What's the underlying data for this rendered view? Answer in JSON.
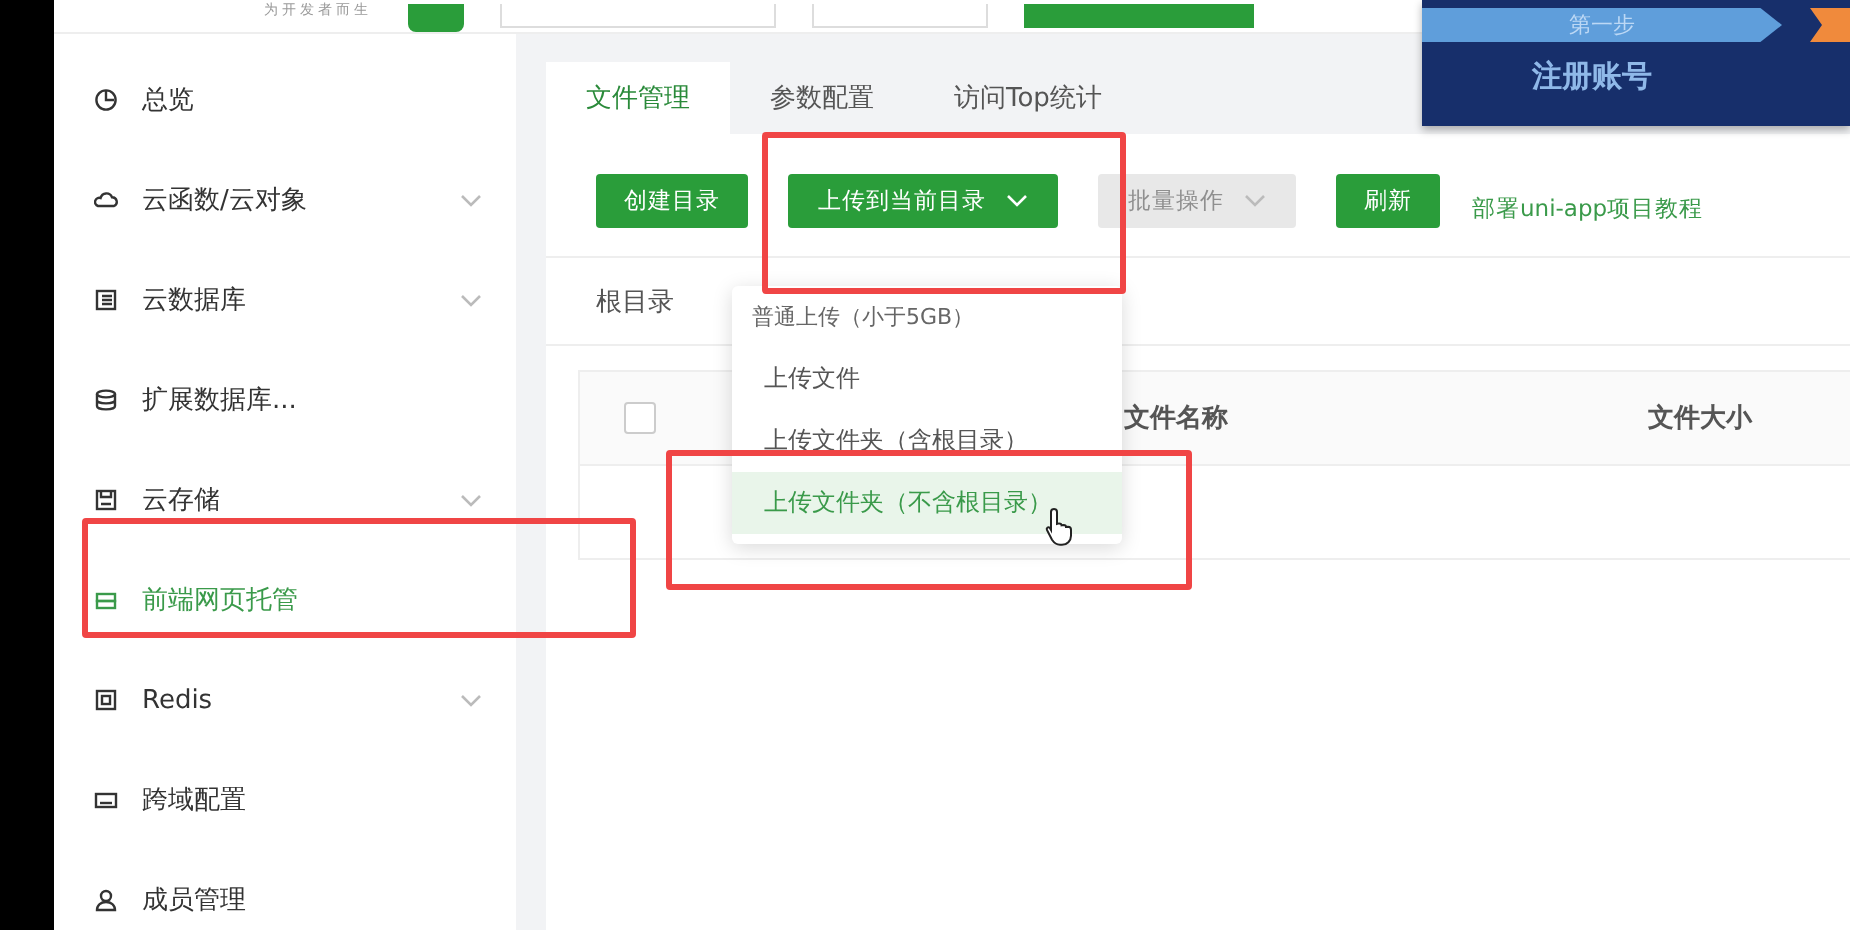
{
  "header": {
    "slogan": "为开发者而生"
  },
  "banner": {
    "step": "第一步",
    "title": "注册账号"
  },
  "sidebar": {
    "items": [
      {
        "label": "总览",
        "expandable": false,
        "selected": false
      },
      {
        "label": "云函数/云对象",
        "expandable": true,
        "selected": false
      },
      {
        "label": "云数据库",
        "expandable": true,
        "selected": false
      },
      {
        "label": "扩展数据库...",
        "expandable": false,
        "selected": false
      },
      {
        "label": "云存储",
        "expandable": true,
        "selected": false
      },
      {
        "label": "前端网页托管",
        "expandable": false,
        "selected": true
      },
      {
        "label": "Redis",
        "expandable": true,
        "selected": false
      },
      {
        "label": "跨域配置",
        "expandable": false,
        "selected": false
      },
      {
        "label": "成员管理",
        "expandable": false,
        "selected": false
      }
    ]
  },
  "tabs": [
    {
      "label": "文件管理",
      "selected": true
    },
    {
      "label": "参数配置",
      "selected": false
    },
    {
      "label": "访问Top统计",
      "selected": false
    }
  ],
  "toolbar": [
    {
      "label": "创建目录",
      "kind": "button"
    },
    {
      "label": "上传到当前目录",
      "kind": "dropdown",
      "disabled": false
    },
    {
      "label": "批量操作",
      "kind": "dropdown",
      "disabled": true
    },
    {
      "label": "刷新",
      "kind": "button"
    },
    {
      "label": "部署uni-app项目教程",
      "kind": "link"
    }
  ],
  "breadcrumb": "根目录",
  "table": {
    "select_all": {
      "checked": false
    },
    "columns": [
      "文件名称",
      "文件大小"
    ]
  },
  "upload_menu": {
    "header": "普通上传（小于5GB）",
    "items": [
      {
        "label": "上传文件",
        "selected": false
      },
      {
        "label": "上传文件夹（含根目录）",
        "selected": false
      },
      {
        "label": "上传文件夹（不含根目录）",
        "selected": true
      }
    ]
  }
}
